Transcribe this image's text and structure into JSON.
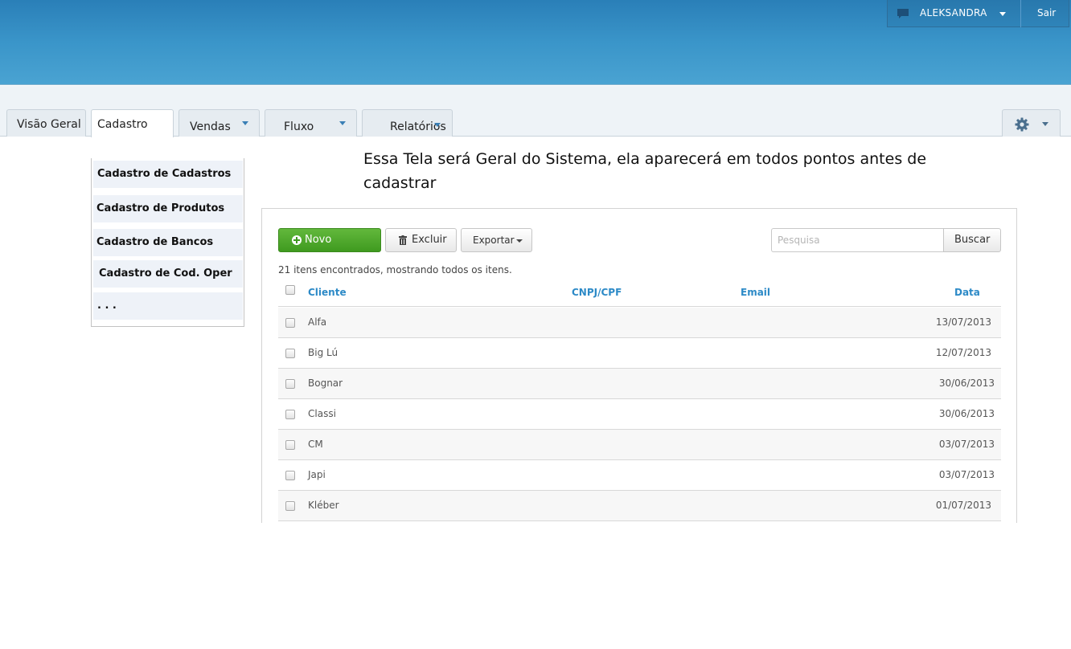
{
  "header": {
    "user_name": "ALEKSANDRA",
    "logout_label": "Sair",
    "chat_icon": "chat-bubble-icon",
    "accent_color": "#3a95c9"
  },
  "tabs": [
    {
      "label": "Visão Geral"
    },
    {
      "label": "Cadastro"
    },
    {
      "label": "Vendas"
    },
    {
      "label": "Fluxo"
    },
    {
      "label": "Relatórios"
    }
  ],
  "settings_icon": "gear-icon",
  "dropdown": {
    "items": [
      {
        "label": "Cadastro de Cadastros"
      },
      {
        "label": "Cadastro de Produtos"
      },
      {
        "label": "Cadastro de Bancos"
      },
      {
        "label": "Cadastro de Cod. Oper"
      },
      {
        "label": ". . ."
      }
    ]
  },
  "note": "Essa Tela será Geral do Sistema, ela aparecerá em todos pontos antes de cadastrar",
  "toolbar": {
    "new_label": "Novo",
    "delete_label": "Excluir",
    "export_label": "Exportar",
    "search_placeholder": "Pesquisa",
    "search_button": "Buscar"
  },
  "results_text": "21 itens encontrados, mostrando todos os itens.",
  "table": {
    "columns": [
      "Cliente",
      "CNPJ/CPF",
      "Email",
      "Data"
    ],
    "rows": [
      {
        "client": "Alfa",
        "date": "13/07/2013"
      },
      {
        "client": "Big Lú",
        "date": "12/07/2013"
      },
      {
        "client": "Bognar",
        "date": "30/06/2013"
      },
      {
        "client": "Classi",
        "date": "30/06/2013"
      },
      {
        "client": "CM",
        "date": "03/07/2013"
      },
      {
        "client": "Japi",
        "date": "03/07/2013"
      },
      {
        "client": "Kléber",
        "date": "01/07/2013"
      }
    ]
  }
}
